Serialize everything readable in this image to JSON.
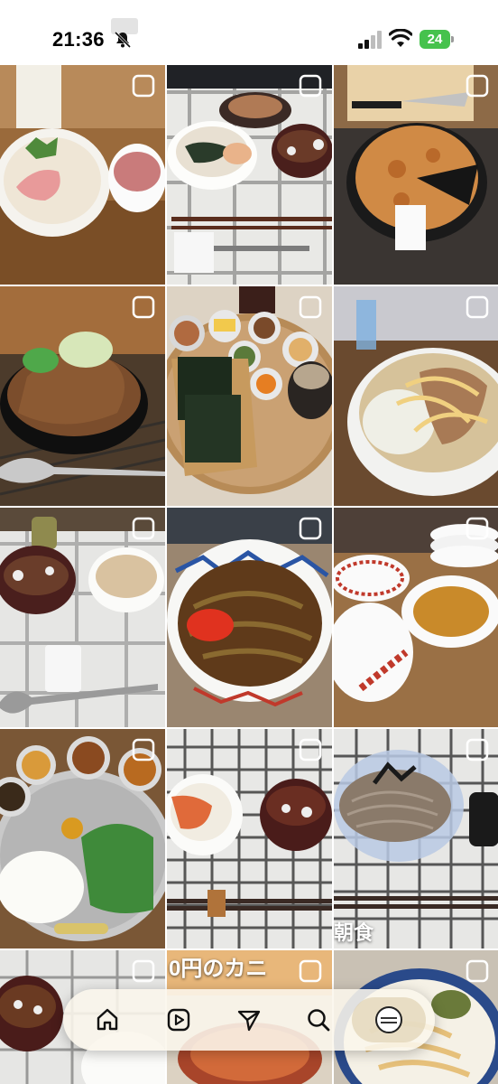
{
  "status_bar": {
    "time": "21:36",
    "battery": "24",
    "icons": [
      "bell-slash-icon",
      "cellular-signal-icon",
      "wifi-icon",
      "battery-icon"
    ],
    "battery_color": "#46c24d"
  },
  "overlay": {
    "caption_breakfast": "朝食",
    "caption_crab": "0円のカニ"
  },
  "nav": {
    "items": [
      {
        "name": "home-icon"
      },
      {
        "name": "reels-icon"
      },
      {
        "name": "send-icon"
      },
      {
        "name": "search-icon"
      },
      {
        "name": "profile-avatar"
      }
    ],
    "active": "profile-avatar"
  },
  "colors": {
    "accent_red": "#c0392b",
    "nav_bg": "#faf6ec"
  }
}
